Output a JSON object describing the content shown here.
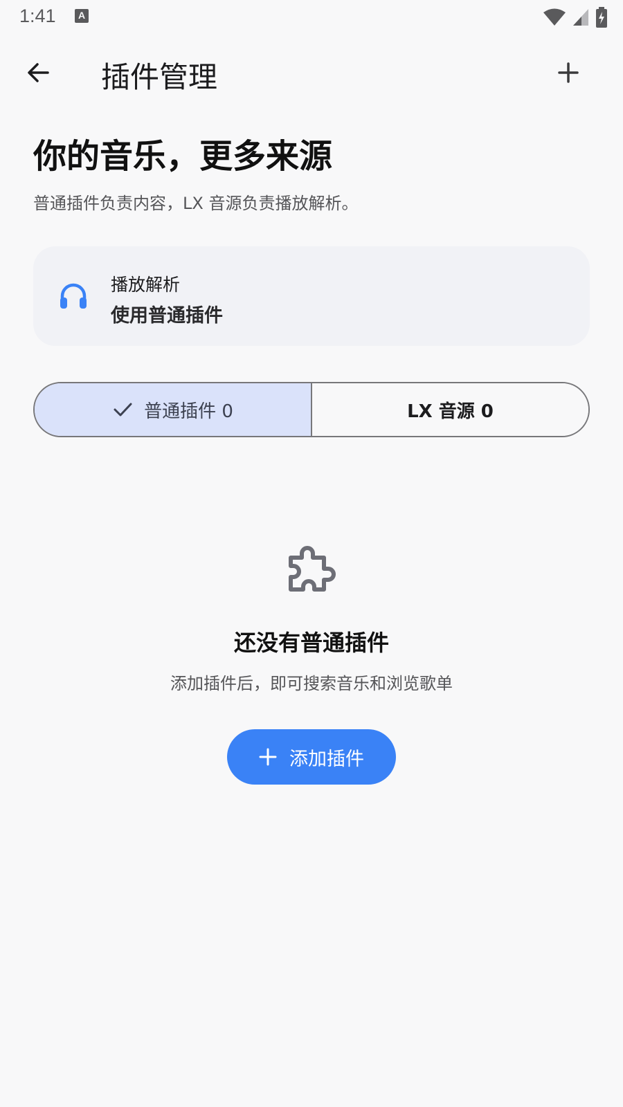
{
  "status_bar": {
    "time": "1:41",
    "notification_icon": "a-icon",
    "right_icons": [
      "wifi-icon",
      "signal-icon",
      "battery-charging-icon"
    ]
  },
  "app_bar": {
    "title": "插件管理",
    "back_icon": "arrow-left-icon",
    "add_icon": "plus-icon"
  },
  "hero": {
    "title": "你的音乐，更多来源",
    "subtitle": "普通插件负责内容，LX 音源负责播放解析。"
  },
  "playback_card": {
    "icon": "headphones-icon",
    "label": "播放解析",
    "value": "使用普通插件"
  },
  "segmented": {
    "tabs": [
      {
        "label": "普通插件 0",
        "selected": true,
        "icon": "check-icon"
      },
      {
        "label": "LX 音源 0",
        "selected": false
      }
    ]
  },
  "empty_state": {
    "icon": "puzzle-icon",
    "title": "还没有普通插件",
    "description": "添加插件后，即可搜索音乐和浏览歌单",
    "button_label": "添加插件",
    "button_icon": "plus-icon"
  },
  "colors": {
    "background": "#f8f8f9",
    "accent": "#3a82f6",
    "selected_segment": "#dae2fa",
    "card": "#f1f2f6"
  }
}
